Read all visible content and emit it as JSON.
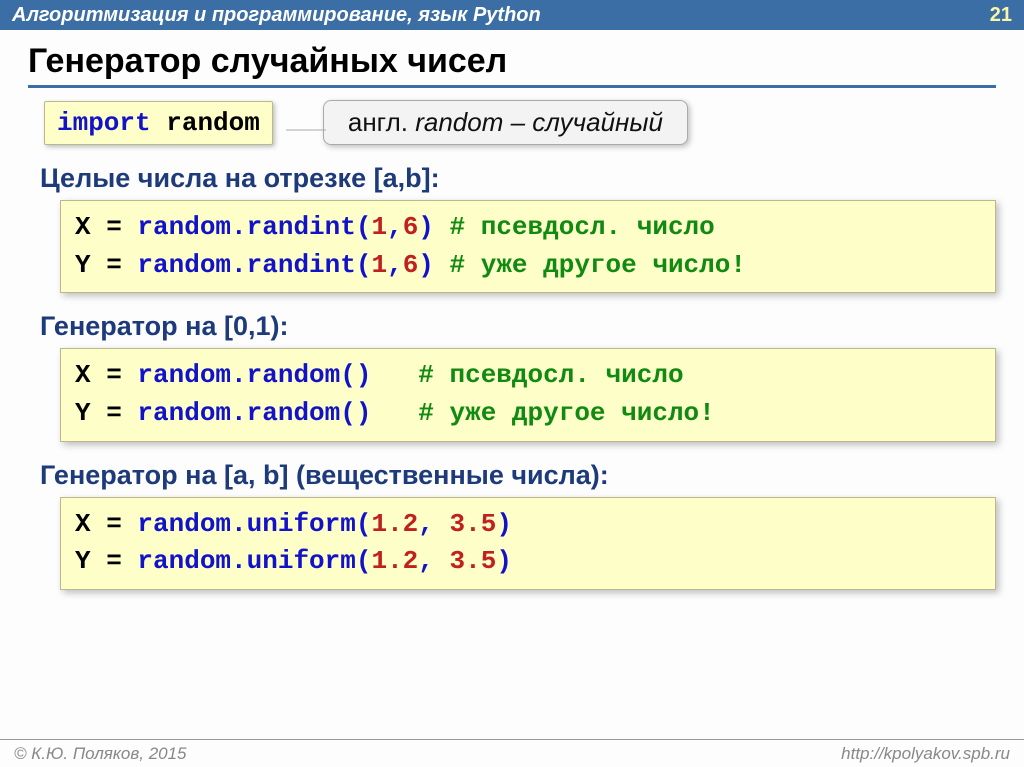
{
  "header": {
    "title": "Алгоритмизация и программирование, язык Python",
    "page": "21"
  },
  "slide": {
    "title": "Генератор случайных чисел",
    "import_code": {
      "kw": "import",
      "mod": "random"
    },
    "callout": {
      "pref": "англ. ",
      "word": "random",
      "suf": " – случайный"
    },
    "sec1": {
      "head": "Целые числа на отрезке [a,b]:",
      "l1": {
        "v": "X",
        "eq": " = ",
        "call": "random.randint",
        "open": "(",
        "a": "1",
        "c": ",",
        "b": "6",
        "close": ")",
        "pad": " ",
        "cmt": "# псевдосл. число"
      },
      "l2": {
        "v": "Y",
        "eq": " = ",
        "call": "random.randint",
        "open": "(",
        "a": "1",
        "c": ",",
        "b": "6",
        "close": ")",
        "pad": " ",
        "cmt": "# уже другое число!"
      }
    },
    "sec2": {
      "head": "Генератор на [0,1):",
      "l1": {
        "v": "X",
        "eq": " = ",
        "call": "random.random",
        "open": "(",
        "close": ")",
        "pad": "   ",
        "cmt": "# псевдосл. число"
      },
      "l2": {
        "v": "Y",
        "eq": " = ",
        "call": "random.random",
        "open": "(",
        "close": ")",
        "pad": "   ",
        "cmt": "# уже другое число!"
      }
    },
    "sec3": {
      "head": "Генератор на [a, b] (вещественные числа):",
      "l1": {
        "v": "X",
        "eq": " = ",
        "call": "random.uniform",
        "open": "(",
        "a": "1.2",
        "c": ", ",
        "b": "3.5",
        "close": ")"
      },
      "l2": {
        "v": "Y",
        "eq": " = ",
        "call": "random.uniform",
        "open": "(",
        "a": "1.2",
        "c": ", ",
        "b": "3.5",
        "close": ")"
      }
    }
  },
  "footer": {
    "copyright": "© К.Ю. Поляков, 2015",
    "url": "http://kpolyakov.spb.ru"
  }
}
